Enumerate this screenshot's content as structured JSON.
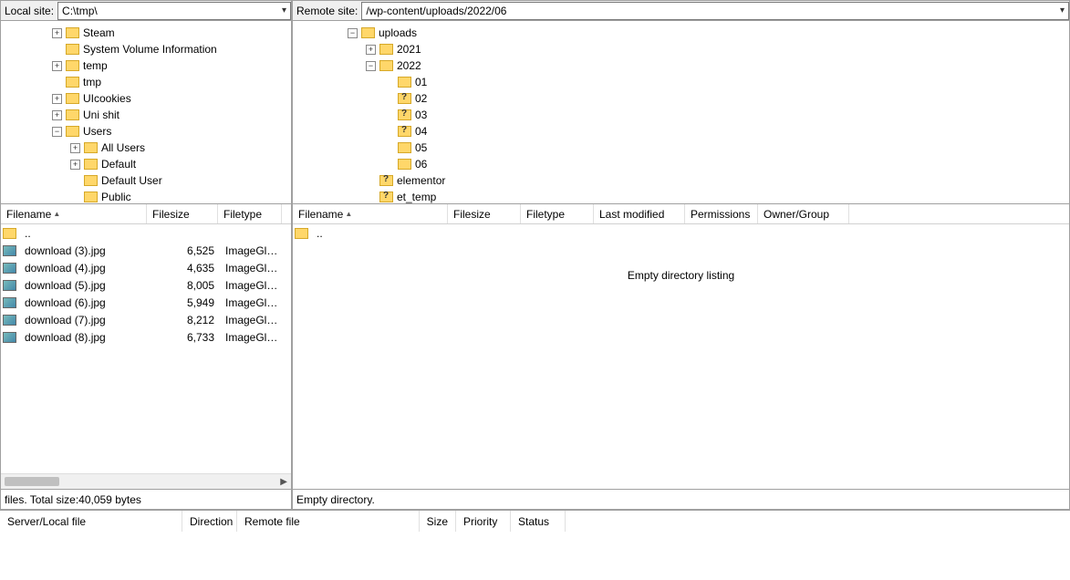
{
  "local": {
    "label": "Local site:",
    "path": "C:\\tmp\\",
    "tree": [
      {
        "indent": 56,
        "expander": "+",
        "icon": "folder",
        "label": "Steam"
      },
      {
        "indent": 56,
        "expander": "",
        "icon": "folder",
        "label": "System Volume Information"
      },
      {
        "indent": 56,
        "expander": "+",
        "icon": "folder",
        "label": "temp"
      },
      {
        "indent": 56,
        "expander": "",
        "icon": "folder",
        "label": "tmp"
      },
      {
        "indent": 56,
        "expander": "+",
        "icon": "folder",
        "label": "UIcookies"
      },
      {
        "indent": 56,
        "expander": "+",
        "icon": "folder",
        "label": "Uni shit"
      },
      {
        "indent": 56,
        "expander": "-",
        "icon": "folder",
        "label": "Users"
      },
      {
        "indent": 76,
        "expander": "+",
        "icon": "folder",
        "label": "All Users"
      },
      {
        "indent": 76,
        "expander": "+",
        "icon": "folder",
        "label": "Default"
      },
      {
        "indent": 76,
        "expander": "",
        "icon": "folder",
        "label": "Default User"
      },
      {
        "indent": 76,
        "expander": "",
        "icon": "folder",
        "label": "Public"
      }
    ],
    "columns": [
      "Filename",
      "Filesize",
      "Filetype"
    ],
    "files": [
      {
        "name": "..",
        "icon": "folder",
        "size": "",
        "type": ""
      },
      {
        "name": "download (3).jpg",
        "icon": "img",
        "size": "6,525",
        "type": "ImageGlass"
      },
      {
        "name": "download (4).jpg",
        "icon": "img",
        "size": "4,635",
        "type": "ImageGlass"
      },
      {
        "name": "download (5).jpg",
        "icon": "img",
        "size": "8,005",
        "type": "ImageGlass"
      },
      {
        "name": "download (6).jpg",
        "icon": "img",
        "size": "5,949",
        "type": "ImageGlass"
      },
      {
        "name": "download (7).jpg",
        "icon": "img",
        "size": "8,212",
        "type": "ImageGlass"
      },
      {
        "name": "download (8).jpg",
        "icon": "img",
        "size": "6,733",
        "type": "ImageGlass"
      }
    ],
    "status_prefix": " files. Total size: ",
    "status_bytes": "40,059 bytes"
  },
  "remote": {
    "label": "Remote site:",
    "path": "/wp-content/uploads/2022/06",
    "tree": [
      {
        "indent": 60,
        "expander": "-",
        "icon": "folder",
        "label": "uploads"
      },
      {
        "indent": 80,
        "expander": "+",
        "icon": "folder",
        "label": "2021"
      },
      {
        "indent": 80,
        "expander": "-",
        "icon": "folder",
        "label": "2022"
      },
      {
        "indent": 100,
        "expander": "",
        "icon": "folder",
        "label": "01"
      },
      {
        "indent": 100,
        "expander": "",
        "icon": "folder-q",
        "label": "02"
      },
      {
        "indent": 100,
        "expander": "",
        "icon": "folder-q",
        "label": "03"
      },
      {
        "indent": 100,
        "expander": "",
        "icon": "folder-q",
        "label": "04"
      },
      {
        "indent": 100,
        "expander": "",
        "icon": "folder",
        "label": "05"
      },
      {
        "indent": 100,
        "expander": "",
        "icon": "folder",
        "label": "06"
      },
      {
        "indent": 80,
        "expander": "",
        "icon": "folder-q",
        "label": "elementor"
      },
      {
        "indent": 80,
        "expander": "",
        "icon": "folder-q",
        "label": "et_temp"
      }
    ],
    "columns": [
      "Filename",
      "Filesize",
      "Filetype",
      "Last modified",
      "Permissions",
      "Owner/Group"
    ],
    "parent": "..",
    "empty_msg": "Empty directory listing",
    "status": "Empty directory."
  },
  "queue": {
    "columns": [
      "Server/Local file",
      "Direction",
      "Remote file",
      "Size",
      "Priority",
      "Status"
    ]
  }
}
